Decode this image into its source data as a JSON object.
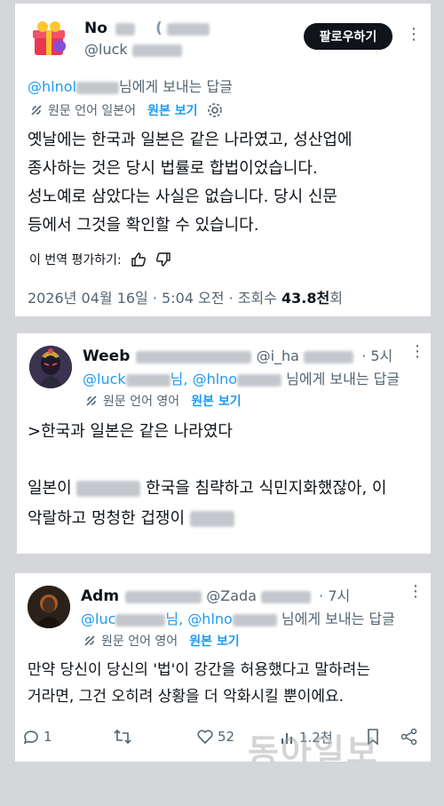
{
  "tweet1": {
    "name_visible": "No",
    "name_paren": "(",
    "handle_visible": "@luck",
    "follow_label": "팔로우하기",
    "more_label": "⋮",
    "reply_to_handle": "@hlnol",
    "reply_suffix": "님에게 보내는 답글",
    "translated_from": "원문 언어 일본어",
    "show_original": "원본 보기",
    "body_lines": [
      "옛날에는 한국과 일본은 같은 나라였고, 성산업에",
      "종사하는 것은 당시 법률로 합법이었습니다.",
      "성노예로 삼았다는 사실은 없습니다. 당시 신문",
      "등에서 그것을 확인할 수 있습니다."
    ],
    "rate_label": "이 번역 평가하기:",
    "meta_prefix": "2026년 04월 16일 · 5:04 오전 · 조회수 ",
    "views_bold": "43.8천",
    "views_suffix": "회"
  },
  "tweet2": {
    "name_visible": "Weeb",
    "handle_visible": "@i_ha",
    "time": "· 5시",
    "reply_handle_a": "@luck",
    "reply_mid": "님,",
    "reply_handle_b": "@hlno",
    "reply_suffix": "님에게 보내는 답글",
    "translated_from": "원문 언어 영어",
    "show_original": "원본 보기",
    "quote_line": ">한국과 일본은 같은 나라였다",
    "line2_a": "일본이",
    "line2_b": "한국을 침략하고 식민지화했잖아, 이",
    "line3_a": "악랄하고 멍청한 겁쟁이"
  },
  "tweet3": {
    "name_visible": "Adm",
    "handle_visible": "@Zada",
    "time": "· 7시",
    "reply_handle_a": "@luc",
    "reply_mid": "님,",
    "reply_handle_b": "@hlno",
    "reply_suffix": "님에게 보내는 답글",
    "translated_from": "원문 언어 영어",
    "show_original": "원본 보기",
    "body_lines": [
      "만약 당신이 당신의 '법'이 강간을 허용했다고 말하려는",
      "거라면, 그건 오히려 상황을 더 악화시킬 뿐이에요."
    ],
    "replies": "1",
    "likes": "52",
    "views": "1.2천"
  },
  "watermark": "동아일보",
  "colors": {
    "link": "#1d9bf0",
    "text": "#0f1419",
    "muted": "#536471",
    "follow_bg": "#0f1419"
  }
}
